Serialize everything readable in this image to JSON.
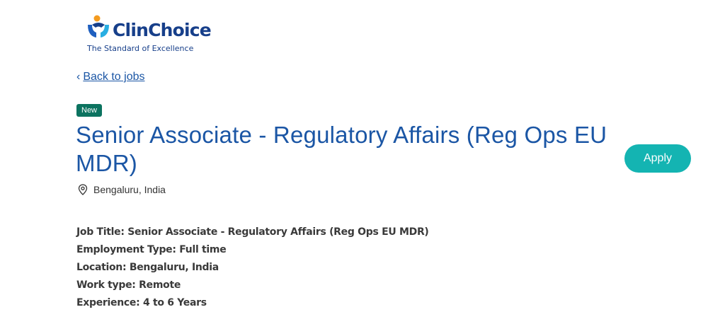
{
  "logo": {
    "name": "ClinChoice",
    "tagline": "The Standard of Excellence",
    "colors": {
      "primary": "#173f8a",
      "accent_orange": "#f49b1f",
      "accent_blue": "#1f5fbf",
      "accent_cyan": "#29aee2"
    }
  },
  "nav": {
    "back_label": "Back to jobs",
    "back_icon": "chevron-left-icon"
  },
  "job": {
    "badge": "New",
    "title": "Senior Associate - Regulatory Affairs (Reg Ops EU MDR)",
    "location": "Bengaluru, India",
    "location_icon": "map-pin-icon"
  },
  "actions": {
    "apply_label": "Apply"
  },
  "details": [
    "Job Title: Senior Associate - Regulatory Affairs (Reg Ops EU MDR)",
    "Employment Type: Full time",
    "Location: Bengaluru, India",
    "Work type: Remote",
    "Experience: 4 to 6 Years"
  ],
  "colors": {
    "title": "#1b56a5",
    "badge_bg": "#0c7360",
    "apply_bg": "#14b4b2",
    "body_text": "#3a3a3a"
  }
}
